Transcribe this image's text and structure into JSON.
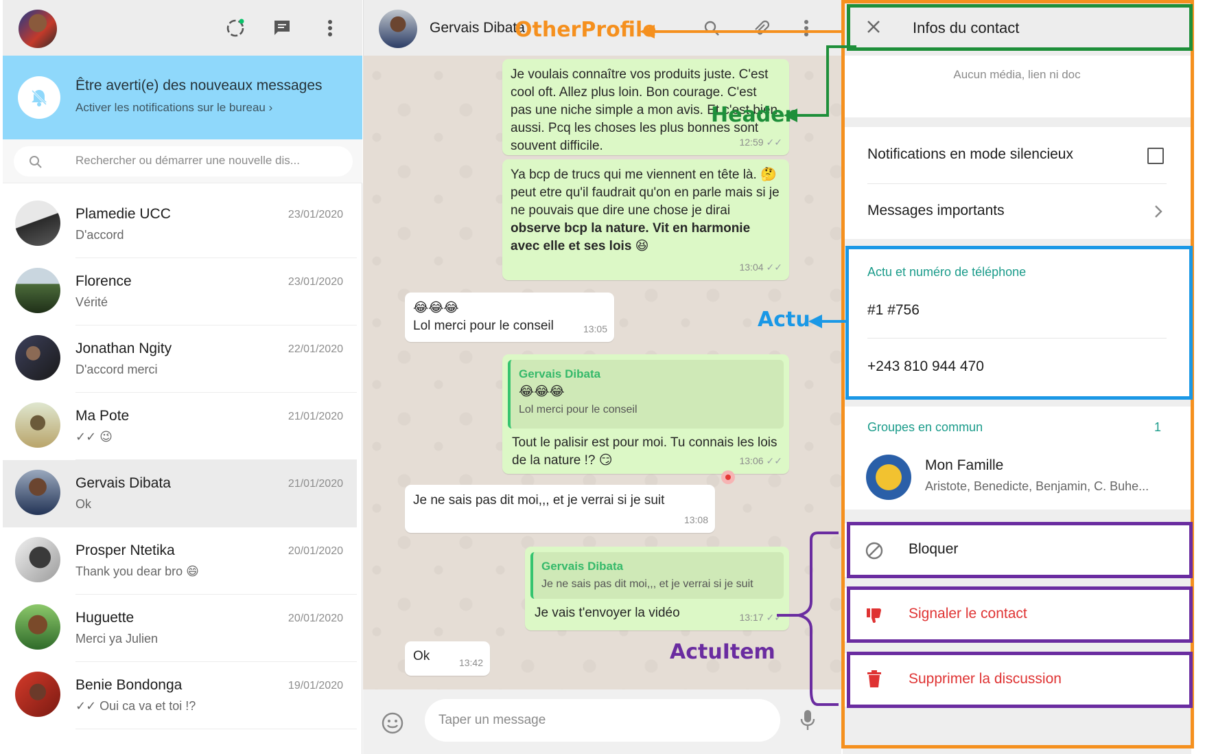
{
  "sidebar": {
    "banner": {
      "title": "Être averti(e) des nouveaux messages",
      "subtitle": "Activer les notifications sur le bureau ›"
    },
    "search_placeholder": "Rechercher ou démarrer une nouvelle dis...",
    "chats": [
      {
        "name": "Plamedie UCC",
        "date": "23/01/2020",
        "last": "D'accord"
      },
      {
        "name": "Florence",
        "date": "23/01/2020",
        "last": "Vérité"
      },
      {
        "name": "Jonathan Ngity",
        "date": "22/01/2020",
        "last": "D'accord merci"
      },
      {
        "name": "Ma Pote",
        "date": "21/01/2020",
        "last": "✓✓ 😉"
      },
      {
        "name": "Gervais Dibata",
        "date": "21/01/2020",
        "last": "Ok"
      },
      {
        "name": "Prosper Ntetika",
        "date": "20/01/2020",
        "last": "Thank you dear bro 😄"
      },
      {
        "name": "Huguette",
        "date": "20/01/2020",
        "last": "Merci ya Julien"
      },
      {
        "name": "Benie Bondonga",
        "date": "19/01/2020",
        "last": "✓✓ Oui ca va et toi !?"
      }
    ]
  },
  "conversation": {
    "contact_name": "Gervais Dibata",
    "messages": [
      {
        "text": "Je voulais connaître vos produits juste. C'est cool oft. Allez plus loin. Bon courage. C'est pas une niche simple a mon avis. Et c'est bien aussi. Pcq les choses les plus bonnes sont souvent difficile.",
        "time": "12:59"
      },
      {
        "text_a": "Ya bcp de trucs qui me viennent en tête là. 🤔 peut etre qu'il faudrait qu'on en parle mais si je ne pouvais que dire une chose je dirai ",
        "text_b": "observe bcp la nature. Vit en harmonie avec elle et ses lois",
        "text_c": " 😆",
        "time": "13:04"
      },
      {
        "emoji": "😂😂😂",
        "text": "Lol merci pour le conseil",
        "time": "13:05"
      },
      {
        "quote_name": "Gervais Dibata",
        "quote_emoji": "😂😂😂",
        "quote_text": "Lol merci pour le conseil",
        "text": "Tout le palisir est pour moi. Tu connais les lois de la nature !? 😏",
        "time": "13:06"
      },
      {
        "text": "Je ne sais pas dit moi,,, et je verrai si je suit",
        "time": "13:08"
      },
      {
        "quote_name": "Gervais Dibata",
        "quote_text": "Je ne sais pas dit moi,,, et je verrai si je suit",
        "text": "Je vais t'envoyer la vidéo",
        "time": "13:17"
      },
      {
        "text": "Ok",
        "time": "13:42"
      }
    ],
    "input_placeholder": "Taper un message"
  },
  "info": {
    "title": "Infos du contact",
    "media_empty": "Aucun média, lien ni doc",
    "mute_label": "Notifications en mode silencieux",
    "starred_label": "Messages importants",
    "about_section": "Actu et numéro de téléphone",
    "about": "#1 #756",
    "phone": "+243 810 944 470",
    "groups_section": "Groupes en commun",
    "groups_count": "1",
    "group_name": "Mon Famille",
    "group_members": "Aristote, Benedicte, Benjamin, C. Buhe...",
    "block_label": "Bloquer",
    "report_label": "Signaler le contact",
    "delete_label": "Supprimer la discussion"
  },
  "annotations": {
    "other_profile": "OtherProfile",
    "header": "Header",
    "actu": "Actu",
    "actu_item": "ActuItem",
    "colors": {
      "orange": "#f5901e",
      "green": "#1e8f3a",
      "blue": "#1a98e6",
      "purple": "#6a2ca0"
    }
  }
}
